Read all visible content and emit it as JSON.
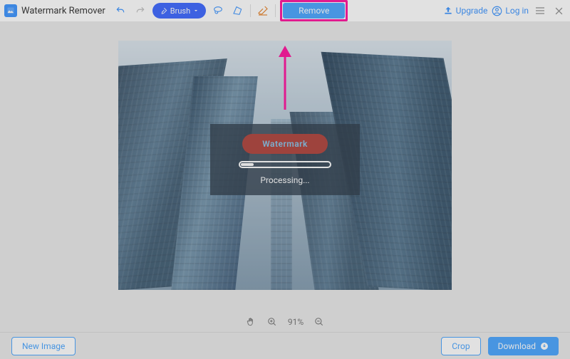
{
  "header": {
    "title": "Watermark Remover",
    "upgrade": "Upgrade",
    "login": "Log in"
  },
  "toolbar": {
    "brush_label": "Brush",
    "remove_label": "Remove"
  },
  "canvas": {
    "watermark_text": "Watermark",
    "processing_label": "Processing..."
  },
  "zoom": {
    "level": "91%"
  },
  "footer": {
    "new_image": "New Image",
    "crop": "Crop",
    "download": "Download"
  },
  "annotation": {
    "highlight_color": "#ff0096",
    "target": "remove-button"
  }
}
